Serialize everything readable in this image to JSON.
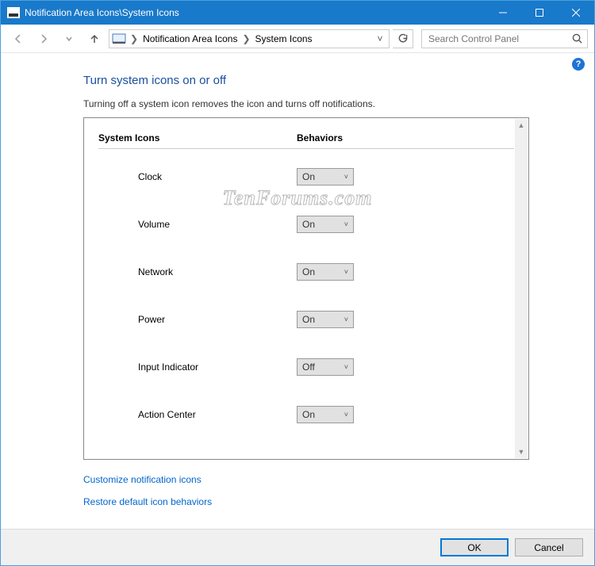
{
  "window": {
    "title": "Notification Area Icons\\System Icons"
  },
  "nav": {
    "crumb1": "Notification Area Icons",
    "crumb2": "System Icons",
    "search_placeholder": "Search Control Panel"
  },
  "page": {
    "heading": "Turn system icons on or off",
    "subtext": "Turning off a system icon removes the icon and turns off notifications.",
    "col1": "System Icons",
    "col2": "Behaviors",
    "watermark": "TenForums.com"
  },
  "rows": [
    {
      "label": "Clock",
      "value": "On"
    },
    {
      "label": "Volume",
      "value": "On"
    },
    {
      "label": "Network",
      "value": "On"
    },
    {
      "label": "Power",
      "value": "On"
    },
    {
      "label": "Input Indicator",
      "value": "Off"
    },
    {
      "label": "Action Center",
      "value": "On"
    }
  ],
  "links": {
    "customize": "Customize notification icons",
    "restore": "Restore default icon behaviors"
  },
  "buttons": {
    "ok": "OK",
    "cancel": "Cancel"
  },
  "help": "?"
}
